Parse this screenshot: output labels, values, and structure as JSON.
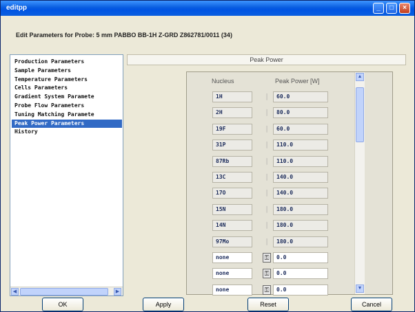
{
  "window": {
    "title": "editpp",
    "header": "Edit Parameters for Probe: 5 mm PABBO BB-1H Z-GRD Z862781/0011 (34)"
  },
  "sidebar": {
    "items": [
      "Production Parameters",
      "Sample Parameters",
      "Temperature Parameters",
      "Cells Parameters",
      "Gradient System Paramete",
      "Probe Flow Parameters",
      "Tuning Matching Paramete",
      "Peak Power Parameters",
      "History"
    ],
    "selected_index": 7
  },
  "panel": {
    "tab_title": "Peak Power",
    "col_nucleus": "Nucleus",
    "col_power": "Peak Power [W]",
    "rows": [
      {
        "nucleus": "1H",
        "power": "60.0",
        "editable": false
      },
      {
        "nucleus": "2H",
        "power": "80.0",
        "editable": false
      },
      {
        "nucleus": "19F",
        "power": "60.0",
        "editable": false
      },
      {
        "nucleus": "31P",
        "power": "110.0",
        "editable": false
      },
      {
        "nucleus": "87Rb",
        "power": "110.0",
        "editable": false
      },
      {
        "nucleus": "13C",
        "power": "140.0",
        "editable": false
      },
      {
        "nucleus": "17O",
        "power": "140.0",
        "editable": false
      },
      {
        "nucleus": "15N",
        "power": "180.0",
        "editable": false
      },
      {
        "nucleus": "14N",
        "power": "180.0",
        "editable": false
      },
      {
        "nucleus": "97Mo",
        "power": "180.0",
        "editable": false
      },
      {
        "nucleus": "none",
        "power": "0.0",
        "editable": true
      },
      {
        "nucleus": "none",
        "power": "0.0",
        "editable": true
      },
      {
        "nucleus": "none",
        "power": "0.0",
        "editable": true
      }
    ]
  },
  "buttons": {
    "ok": "OK",
    "apply": "Apply",
    "reset": "Reset",
    "cancel": "Cancel"
  },
  "colors": {
    "titlebar": "#0a5ee0",
    "selection": "#316ac5",
    "window_bg": "#ece9d8"
  }
}
